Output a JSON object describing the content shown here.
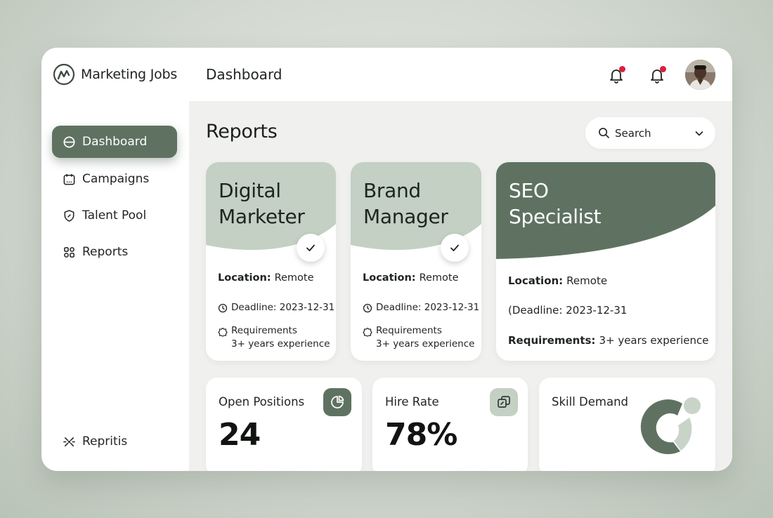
{
  "brand": {
    "name": "Marketing Jobs"
  },
  "header": {
    "page_title": "Dashboard",
    "notification_icons": [
      "bell-icon",
      "bell-icon"
    ]
  },
  "sidebar": {
    "items": [
      {
        "label": "Dashboard",
        "icon": "dashboard-icon",
        "active": true
      },
      {
        "label": "Campaigns",
        "icon": "calendar-icon",
        "active": false
      },
      {
        "label": "Talent Pool",
        "icon": "shield-icon",
        "active": false
      },
      {
        "label": "Reports",
        "icon": "reports-icon",
        "active": false
      }
    ],
    "footer_item": {
      "label": "Repritis",
      "icon": "sparkle-icon"
    }
  },
  "main": {
    "title": "Reports",
    "search": {
      "placeholder": "Search"
    },
    "job_cards": [
      {
        "title_line1": "Digital",
        "title_line2": "Marketer",
        "location_label": "Location:",
        "location": "Remote",
        "deadline": "Deadline: 2023-12-31",
        "requirements_label": "Requirements",
        "requirements": "3+ years experience"
      },
      {
        "title_line1": "Brand",
        "title_line2": "Manager",
        "location_label": "Location:",
        "location": "Remote",
        "deadline": "Deadline: 2023-12-31",
        "requirements_label": "Requirements",
        "requirements": "3+ years experience"
      },
      {
        "title_line1": "SEO",
        "title_line2": "Specialist",
        "location_label": "Location:",
        "location": "Remote",
        "deadline": "(Deadline: 2023-12-31",
        "requirements_label": "Requirements:",
        "requirements": "3+ years experience"
      }
    ],
    "stats": [
      {
        "label": "Open Positions",
        "value": "24",
        "icon": "pie-chart-icon"
      },
      {
        "label": "Hire Rate",
        "value": "78%",
        "icon": "copy-icon"
      },
      {
        "label": "Skill Demand",
        "icon": "donut-chart"
      }
    ]
  },
  "colors": {
    "accent_dark": "#5f7261",
    "accent_light": "#c3d0c3",
    "alert": "#d8213d",
    "page_bg": "#f0f1ef"
  }
}
